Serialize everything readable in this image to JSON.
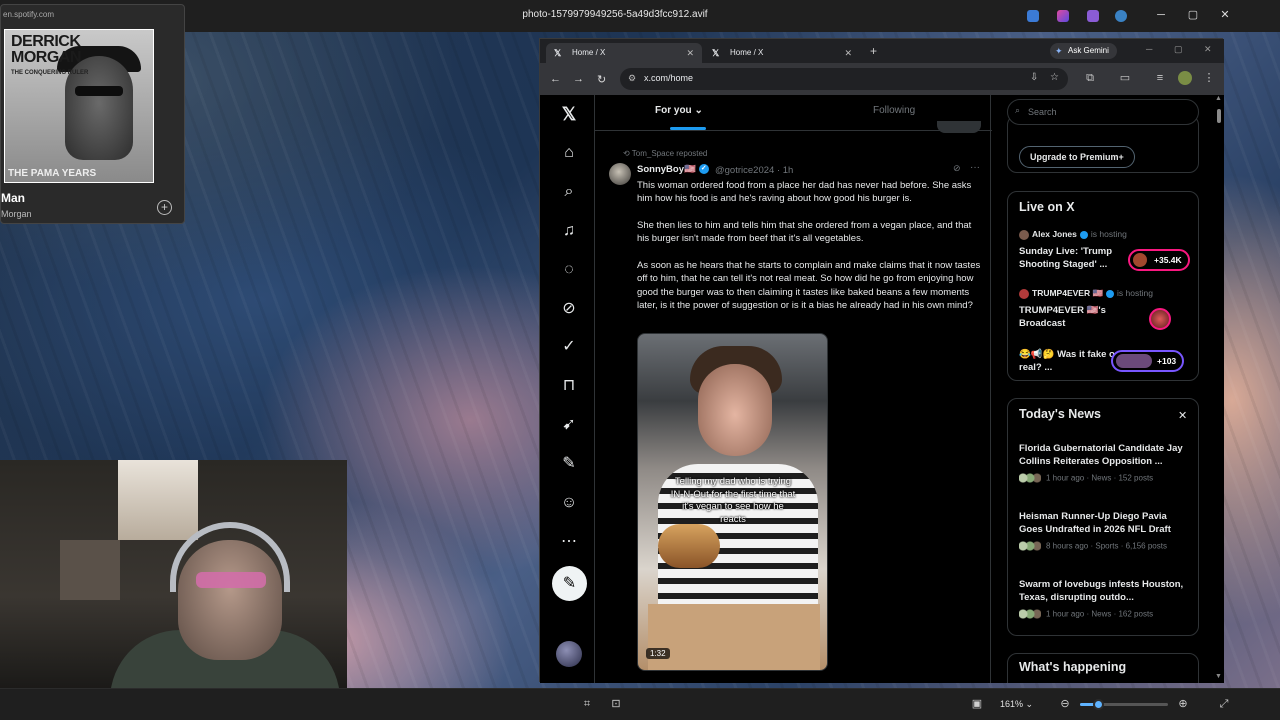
{
  "viewer": {
    "file_name": "photo-1579979949256-5a49d3fcc912.avif",
    "zoom": "161%",
    "zoom_level": 0.2,
    "minimize": "─",
    "maximize": "▢",
    "close": "✕"
  },
  "spotify": {
    "url": "en.spotify.com",
    "cover_title_1": "DERRICK",
    "cover_title_2": "MORGAN",
    "cover_subtitle": "THE CONQUERING RULER",
    "cover_bottom": "THE PAMA YEARS",
    "track": "Man",
    "artist": "Morgan",
    "add_icon": "+"
  },
  "browser": {
    "tabs": [
      {
        "label": "Home / X",
        "close": "✕"
      },
      {
        "label": "Home / X",
        "close": "✕"
      }
    ],
    "new_tab": "+",
    "gemini_label": "Ask Gemini",
    "url": "x.com/home",
    "back": "←",
    "forward": "→",
    "reload": "↻"
  },
  "x": {
    "tabs": {
      "for_you": "For you",
      "following": "Following"
    },
    "repost_line": "Tom_Space reposted",
    "post": {
      "author": "SonnyBoy🇺🇸",
      "handle": "@gotrice2024 · 1h",
      "text_1": "This woman ordered food from a place her dad has never had before. She asks him how his food is and he's raving about how good his burger is.",
      "text_2": "She then lies to him and tells him that she ordered from a vegan place, and that his burger isn't made from beef that it's all vegetables.",
      "text_3": "As soon as he hears that he starts to complain and make claims that it now tastes off to him, that he can tell it's not real meat. So how did he go from enjoying how good the burger was to then claiming it tastes like baked beans a few moments later, is it the power of suggestion or is it a bias he already had in his own mind?",
      "video_caption": "Telling my dad who is trying IN-N-Out for the first time that it's vegan to see how he reacts",
      "duration": "1:32",
      "more": "···"
    },
    "search_placeholder": "Search",
    "premium_button": "Upgrade to Premium+",
    "live": {
      "title": "Live on X",
      "items": [
        {
          "host": "Alex Jones",
          "status": "is hosting",
          "title": "Sunday Live: 'Trump Shooting Staged' ...",
          "count": "+35.4K"
        },
        {
          "host": "TRUMP4EVER 🇺🇸",
          "status": "is hosting",
          "title": "TRUMP4EVER 🇺🇸's Broadcast",
          "count": ""
        },
        {
          "host": "",
          "status": "",
          "title": "😂📢🤔 Was it fake or real? ...",
          "count": "+103"
        }
      ]
    },
    "news": {
      "title": "Today's News",
      "close": "✕",
      "items": [
        {
          "title": "Florida Gubernatorial Candidate Jay Collins Reiterates Opposition ...",
          "meta": "1 hour ago · News · 152 posts"
        },
        {
          "title": "Heisman Runner-Up Diego Pavia Goes Undrafted in 2026 NFL Draft",
          "meta": "8 hours ago · Sports · 6,156 posts"
        },
        {
          "title": "Swarm of lovebugs infests Houston, Texas, disrupting outdo...",
          "meta": "1 hour ago · News · 162 posts"
        }
      ]
    },
    "happening_title": "What's happening"
  }
}
